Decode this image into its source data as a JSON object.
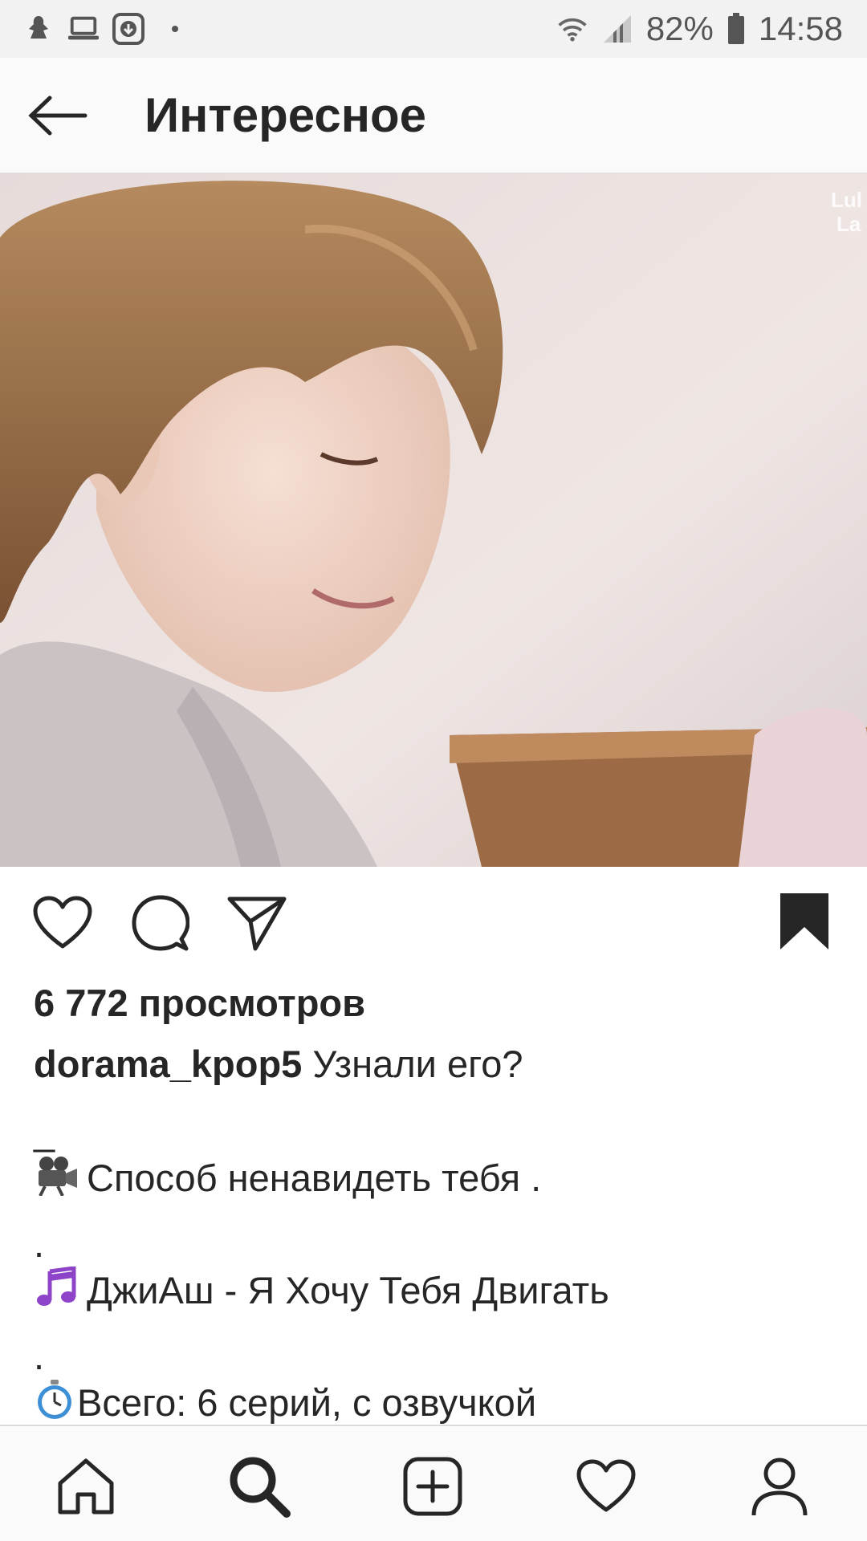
{
  "status_bar": {
    "battery": "82%",
    "time": "14:58",
    "left_icons": [
      "notification-icon",
      "laptop-icon",
      "download-icon"
    ],
    "right_icons": [
      "wifi-icon",
      "signal-icon",
      "battery-icon"
    ]
  },
  "header": {
    "title": "Интересное",
    "back_icon": "arrow-left-icon"
  },
  "media": {
    "watermark": "Lul La"
  },
  "actions": {
    "icons": [
      "heart-icon",
      "comment-icon",
      "share-icon",
      "bookmark-icon"
    ]
  },
  "post": {
    "views": "6 772 просмотров",
    "username": "dorama_kpop5",
    "caption_first": "Узнали его?",
    "line_dash": "_",
    "line_title": "Способ ненавидеть тебя .",
    "line_dot1": ".",
    "line_song": "ДжиАш - Я Хочу Тебя Двигать",
    "line_dot2": ".",
    "line_series": "Всего: 6 серий, с озвучкой"
  },
  "bottom_nav": {
    "items": [
      "home-icon",
      "search-icon",
      "add-post-icon",
      "activity-heart-icon",
      "profile-icon"
    ],
    "active": "search-icon"
  }
}
